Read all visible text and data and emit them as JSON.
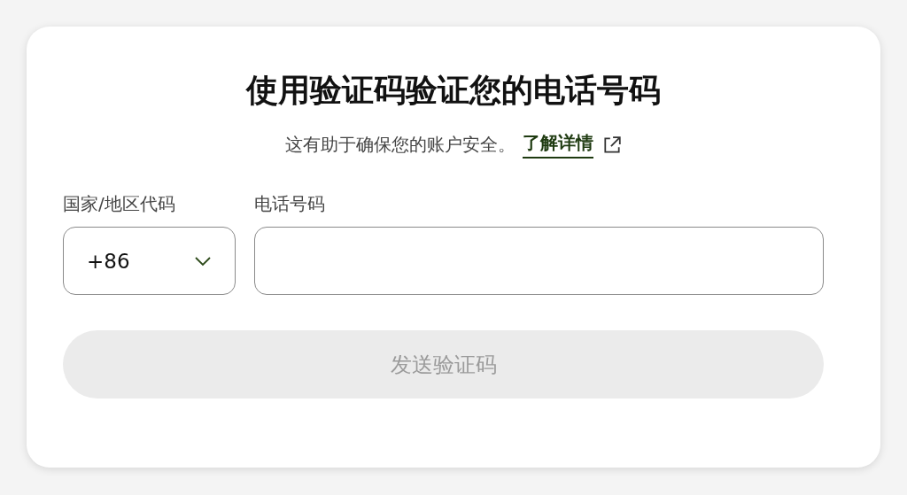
{
  "title": "使用验证码验证您的电话号码",
  "subtitle": {
    "text": "这有助于确保您的账户安全。",
    "link": "了解详情"
  },
  "country_code": {
    "label": "国家/地区代码",
    "value": "+86"
  },
  "phone": {
    "label": "电话号码"
  },
  "send_button": {
    "label": "发送验证码",
    "disabled": true
  }
}
